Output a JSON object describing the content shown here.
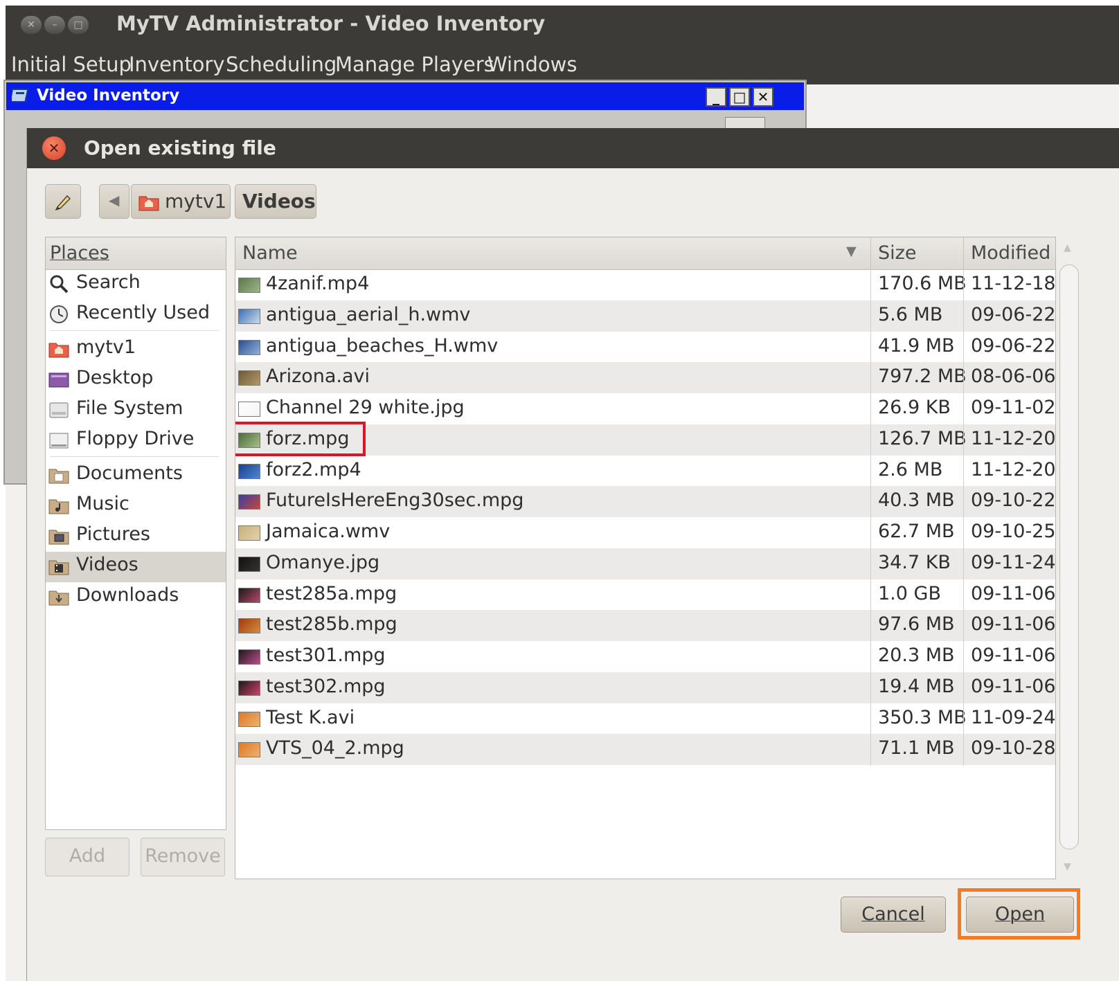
{
  "app": {
    "title": "MyTV Administrator - Video Inventory",
    "menu": [
      "Initial Setup",
      "Inventory",
      "Scheduling",
      "Manage Players",
      "Windows"
    ]
  },
  "inner_window": {
    "title": "Video Inventory"
  },
  "dialog": {
    "title": "Open existing file",
    "path": [
      "mytv1",
      "Videos"
    ],
    "places_header": "Places",
    "places": [
      {
        "label": "Search",
        "icon": "search-icon"
      },
      {
        "label": "Recently Used",
        "icon": "clock-icon"
      },
      {
        "label": "mytv1",
        "icon": "home-folder-icon"
      },
      {
        "label": "Desktop",
        "icon": "desktop-icon"
      },
      {
        "label": "File System",
        "icon": "harddisk-icon"
      },
      {
        "label": "Floppy Drive",
        "icon": "floppy-icon"
      },
      {
        "label": "Documents",
        "icon": "documents-folder-icon"
      },
      {
        "label": "Music",
        "icon": "music-folder-icon"
      },
      {
        "label": "Pictures",
        "icon": "pictures-folder-icon"
      },
      {
        "label": "Videos",
        "icon": "videos-folder-icon",
        "selected": true
      },
      {
        "label": "Downloads",
        "icon": "downloads-folder-icon"
      }
    ],
    "add_label": "Add",
    "remove_label": "Remove",
    "columns": {
      "name": "Name",
      "size": "Size",
      "modified": "Modified"
    },
    "files": [
      {
        "name": "4zanif.mp4",
        "size": "170.6 MB",
        "modified": "11-12-18"
      },
      {
        "name": "antigua_aerial_h.wmv",
        "size": "5.6 MB",
        "modified": "09-06-22"
      },
      {
        "name": "antigua_beaches_H.wmv",
        "size": "41.9 MB",
        "modified": "09-06-22"
      },
      {
        "name": "Arizona.avi",
        "size": "797.2 MB",
        "modified": "08-06-06"
      },
      {
        "name": "Channel 29 white.jpg",
        "size": "26.9 KB",
        "modified": "09-11-02"
      },
      {
        "name": "forz.mpg",
        "size": "126.7 MB",
        "modified": "11-12-20",
        "highlighted": true
      },
      {
        "name": "forz2.mp4",
        "size": "2.6 MB",
        "modified": "11-12-20"
      },
      {
        "name": "FutureIsHereEng30sec.mpg",
        "size": "40.3 MB",
        "modified": "09-10-22"
      },
      {
        "name": "Jamaica.wmv",
        "size": "62.7 MB",
        "modified": "09-10-25"
      },
      {
        "name": "Omanye.jpg",
        "size": "34.7 KB",
        "modified": "09-11-24"
      },
      {
        "name": "test285a.mpg",
        "size": "1.0 GB",
        "modified": "09-11-06"
      },
      {
        "name": "test285b.mpg",
        "size": "97.6 MB",
        "modified": "09-11-06"
      },
      {
        "name": "test301.mpg",
        "size": "20.3 MB",
        "modified": "09-11-06"
      },
      {
        "name": "test302.mpg",
        "size": "19.4 MB",
        "modified": "09-11-06"
      },
      {
        "name": "Test K.avi",
        "size": "350.3 MB",
        "modified": "11-09-24"
      },
      {
        "name": "VTS_04_2.mpg",
        "size": "71.1 MB",
        "modified": "09-10-28"
      }
    ],
    "cancel_label": "Cancel",
    "open_label": "Open"
  },
  "colors": {
    "titlebar": "#3c3b37",
    "inner_title": "#0a1de8",
    "highlight_file": "#e0141e",
    "highlight_open": "#f57b20"
  }
}
